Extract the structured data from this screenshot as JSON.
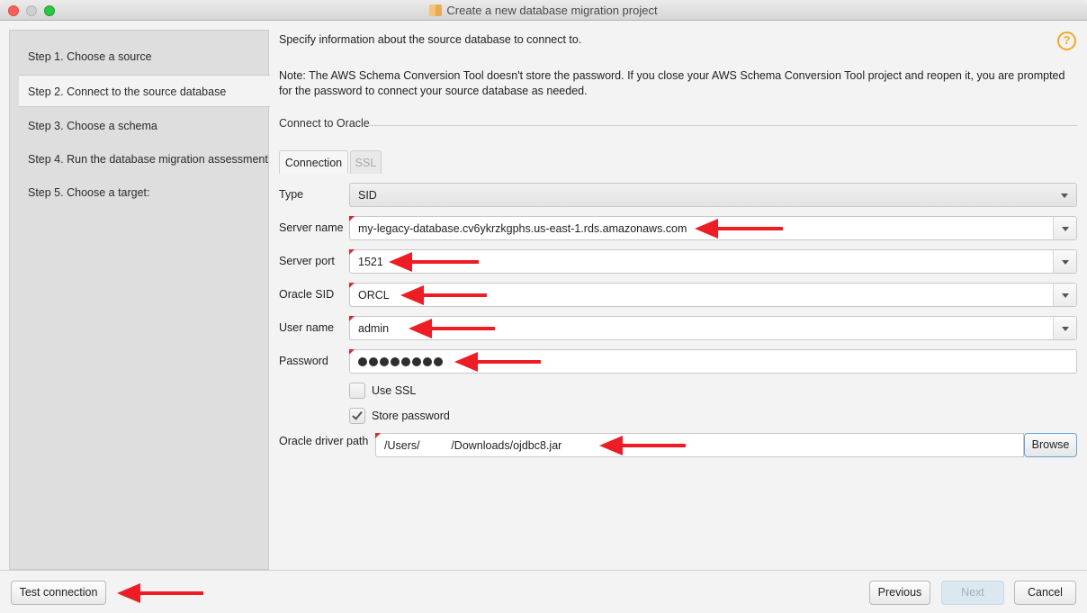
{
  "window": {
    "title": "Create a new database migration project"
  },
  "steps": [
    {
      "label": "Step 1. Choose a source",
      "active": false
    },
    {
      "label": "Step 2. Connect to the source database",
      "active": true
    },
    {
      "label": "Step 3. Choose a schema",
      "active": false
    },
    {
      "label": "Step 4. Run the database migration assessment",
      "active": false
    },
    {
      "label": "Step 5. Choose a target:",
      "active": false
    }
  ],
  "main": {
    "info": "Specify information about the source database to connect to.",
    "note": "Note: The AWS Schema Conversion Tool doesn't store the password. If you close your AWS Schema Conversion Tool project and reopen it, you are prompted for the password to connect your source database as needed.",
    "help_icon": "?",
    "section_title": "Connect to Oracle",
    "tabs": [
      {
        "label": "Connection",
        "active": true
      },
      {
        "label": "SSL",
        "active": false,
        "disabled": true
      }
    ]
  },
  "form": {
    "type": {
      "label": "Type",
      "value": "SID"
    },
    "server_name": {
      "label": "Server name",
      "value": "my-legacy-database.cv6ykrzkgphs.us-east-1.rds.amazonaws.com"
    },
    "server_port": {
      "label": "Server port",
      "value": "1521"
    },
    "oracle_sid": {
      "label": "Oracle SID",
      "value": "ORCL"
    },
    "user_name": {
      "label": "User name",
      "value": "admin"
    },
    "password": {
      "label": "Password",
      "masked_length": 8
    },
    "use_ssl": {
      "label": "Use SSL",
      "checked": false
    },
    "store_password": {
      "label": "Store password",
      "checked": true
    },
    "driver_path": {
      "label": "Oracle driver path",
      "value": "/Users/          /Downloads/ojdbc8.jar"
    },
    "browse_label": "Browse"
  },
  "footer": {
    "test_connection": "Test connection",
    "previous": "Previous",
    "next": "Next",
    "cancel": "Cancel"
  },
  "colors": {
    "annotation_arrow": "#ee1d23",
    "help_icon": "#f7a81b",
    "required_flag": "#e3262e"
  }
}
